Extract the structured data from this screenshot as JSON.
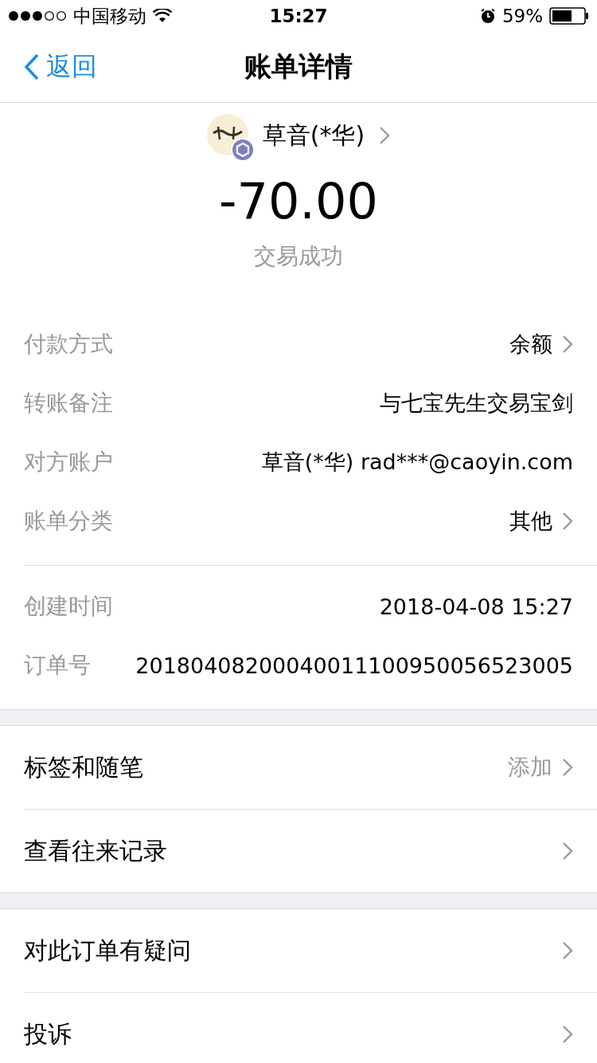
{
  "status_bar": {
    "carrier": "中国移动",
    "time": "15:27",
    "battery": "59%"
  },
  "nav": {
    "back": "返回",
    "title": "账单详情"
  },
  "payee": {
    "name": "草音(*华)",
    "amount": "-70.00",
    "status": "交易成功"
  },
  "detail_groups": [
    [
      {
        "label": "付款方式",
        "value": "余额",
        "arrow": true
      },
      {
        "label": "转账备注",
        "value": "与七宝先生交易宝剑",
        "arrow": false
      },
      {
        "label": "对方账户",
        "value": "草音(*华) rad***@caoyin.com",
        "arrow": false
      },
      {
        "label": "账单分类",
        "value": "其他",
        "arrow": true
      }
    ],
    [
      {
        "label": "创建时间",
        "value": "2018-04-08 15:27",
        "arrow": false
      },
      {
        "label": "订单号",
        "value": "20180408200040011100950056523005",
        "arrow": false
      }
    ]
  ],
  "menu_sections": [
    [
      {
        "label": "标签和随笔",
        "value": "添加"
      },
      {
        "label": "查看往来记录"
      }
    ],
    [
      {
        "label": "对此订单有疑问"
      },
      {
        "label": "投诉"
      }
    ]
  ]
}
